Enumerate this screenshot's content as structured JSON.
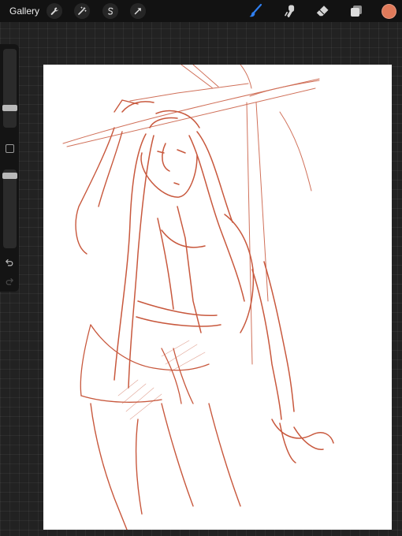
{
  "topbar": {
    "gallery_label": "Gallery",
    "actions": [
      {
        "name": "wrench-icon"
      },
      {
        "name": "adjustments-wand-icon"
      },
      {
        "name": "selection-s-icon"
      },
      {
        "name": "transform-arrow-icon"
      }
    ],
    "tools": [
      {
        "name": "brush-icon",
        "active": true
      },
      {
        "name": "smudge-icon",
        "active": false
      },
      {
        "name": "eraser-icon",
        "active": false
      },
      {
        "name": "layers-icon",
        "active": false
      }
    ],
    "current_color": "#e07a5a"
  },
  "sidebar": {
    "brush_size_level": 0.5,
    "opacity_level": 0.92
  },
  "colors": {
    "accent_active": "#2f7ff0",
    "sketch_stroke": "#c8583d",
    "canvas_bg": "#ffffff"
  }
}
